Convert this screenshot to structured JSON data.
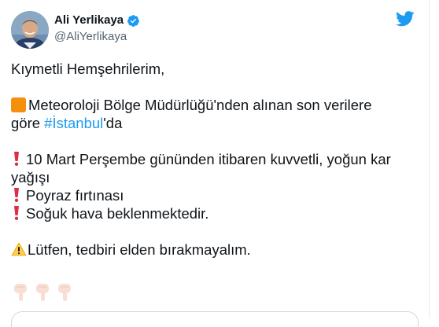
{
  "author": {
    "name": "Ali Yerlikaya",
    "handle": "@AliYerlikaya",
    "verified": true,
    "avatar_icon": "avatar-photo"
  },
  "brand": {
    "icon": "twitter-bird-icon",
    "color": "#1d9bf0"
  },
  "tweet": {
    "greeting": "Kıymetli Hemşehrilerim,",
    "line1_text": "Meteoroloji Bölge Müdürlüğü'nden alınan son verilere",
    "line2_prefix": "göre ",
    "hashtag": "#İstanbul",
    "line2_suffix": "'da",
    "alert1": "10 Mart Perşembe gününden itibaren kuvvetli, yoğun kar yağışı",
    "alert2": "Poyraz fırtınası",
    "alert3": "Soğuk hava beklenmektedir.",
    "warning": "Lütfen, tedbiri elden bırakmayalım."
  },
  "emoji_icons": {
    "square": "orange-square-icon",
    "exclamation": "red-exclamation-icon",
    "warning": "warning-sign-icon",
    "pointing": "pointing-down-icon"
  },
  "colors": {
    "text": "#0f1419",
    "secondary": "#536471",
    "link": "#1d9bf0",
    "verified": "#1d9bf0",
    "orange_square": "#f4900c",
    "exclamation": "#dd2e44",
    "warning_yellow": "#ffcc4d"
  }
}
